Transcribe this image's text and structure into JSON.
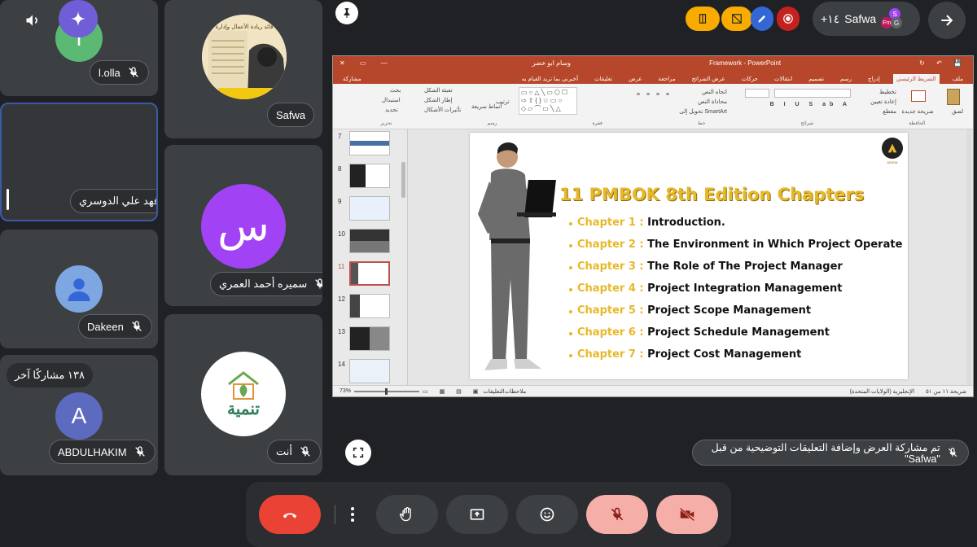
{
  "participants": {
    "lolla": {
      "name": "l.olla",
      "initial": "l",
      "color": "#5bb974"
    },
    "safwa": {
      "name": "Safwa"
    },
    "fahad": {
      "name": "فهد علي الدوسري"
    },
    "samira": {
      "name": "سميره أحمد العمري",
      "initial": "س",
      "color": "#a142f4"
    },
    "dakeen": {
      "name": "Dakeen"
    },
    "others": {
      "count_label": "١٣٨ مشاركًا آخر"
    },
    "abdulhakim": {
      "name": "ABDULHAKIM",
      "initial": "A",
      "color": "#5c6bc0"
    },
    "you": {
      "name": "أنت",
      "logo_text": "تنمية"
    }
  },
  "top_bar": {
    "presenter_chip": "Safwa",
    "presenter_count": "+١٤",
    "avatar_labels": [
      "S",
      "Fm",
      "G"
    ]
  },
  "thumbnail_book_text": "قائد ريادة الأعمال وإدارة",
  "presentation": {
    "window_title": "Framework - PowerPoint",
    "user_name": "وسام ابو خضر",
    "ribbon_tabs": [
      "ملف",
      "الشريط الرئيسي",
      "إدراج",
      "رسم",
      "تصميم",
      "انتقالات",
      "حركات",
      "عرض الشرائح",
      "مراجعة",
      "عرض",
      "تعليقات"
    ],
    "tell_me": "أخبرني بما تريد القيام به",
    "share": "مشاركة",
    "ribbon_groups": [
      "الحافظة",
      "شرائح",
      "خط",
      "فقرة",
      "رسم",
      "تحرير"
    ],
    "ribbon_items": {
      "find": "بحث",
      "replace": "استبدال",
      "select": "تحديد",
      "paste": "لصق",
      "new_slide": "شريحة جديدة",
      "layout": "تخطيط",
      "reset": "إعادة تعيين",
      "section": "مقطع",
      "text_direction": "اتجاه النص",
      "align_text": "محاذاة النص",
      "smartart": "تحويل إلى SmartArt",
      "arrange": "ترتيب",
      "quick_styles": "أنماط سريعة",
      "shape_fill": "تعبئة الشكل",
      "shape_outline": "إطار الشكل",
      "shape_effects": "تأثيرات الأشكال"
    },
    "slide_numbers": [
      "7",
      "8",
      "9",
      "10",
      "11",
      "12",
      "13",
      "14"
    ],
    "selected_slide": "11",
    "status": {
      "slide_info": "شريحة ١١ من ٥١",
      "language": "الإنجليزية (الولايات المتحدة)",
      "notes": "ملاحظات",
      "comments": "التعليقات",
      "zoom": "73%"
    },
    "slide": {
      "title": "11 PMBOK  8th Edition Chapters",
      "logo_text": "ADIRIA",
      "chapters": [
        {
          "label": "Chapter 1 :",
          "text": "Introduction."
        },
        {
          "label": "Chapter 2 :",
          "text": "The Environment in Which Project Operate"
        },
        {
          "label": "Chapter 3 :",
          "text": "The Role of The Project Manager"
        },
        {
          "label": "Chapter 4 :",
          "text": "Project Integration Management"
        },
        {
          "label": "Chapter 5 :",
          "text": "Project Scope Management"
        },
        {
          "label": "Chapter 6 :",
          "text": "Project Schedule Management"
        },
        {
          "label": "Chapter 7 :",
          "text": "Project Cost Management"
        }
      ]
    }
  },
  "annotation_notice": "تم مشاركة العرض وإضافة التعليقات التوضيحية من قبل \"Safwa\"",
  "colors": {
    "accent_red": "#ea4335",
    "warn_yellow": "#f9ab00",
    "muted_pink": "#f6aea9",
    "chapter_gold": "#e8b829"
  }
}
